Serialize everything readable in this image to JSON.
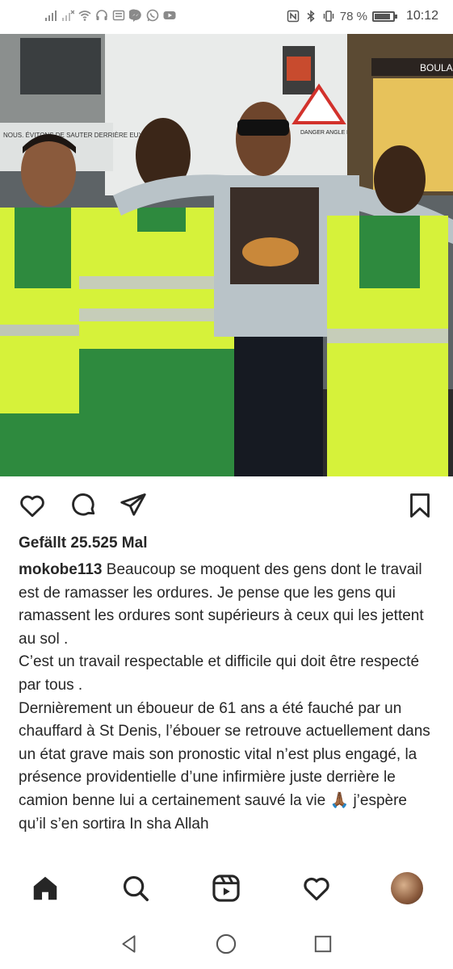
{
  "status_bar": {
    "battery_percent_text": "78 %",
    "battery_level": 0.78,
    "time": "10:12",
    "left_icons": [
      "signal-icon",
      "signal-no-sim-icon",
      "wifi-icon",
      "headphones-icon",
      "news-icon",
      "messenger-icon",
      "whatsapp-icon",
      "youtube-icon"
    ],
    "right_icons": [
      "nfc-icon",
      "bluetooth-icon",
      "vibrate-icon",
      "battery-icon"
    ]
  },
  "photo": {
    "sign_truck_text": "NOUS. ÉVITONS DE SAUTER DERRIÈRE EUX.",
    "sign_danger_text": "DANGER ANGLE MORT",
    "sign_shop_text": "BOULA"
  },
  "actions": {
    "icons": [
      "heart-icon",
      "comment-icon",
      "share-icon",
      "bookmark-icon"
    ]
  },
  "post": {
    "likes": "Gefällt 25.525 Mal",
    "username": "mokobe113",
    "caption_line1": " Beaucoup se moquent des gens dont le travail est de ramasser les ordures. Je pense que les gens qui ramassent les ordures sont supérieurs à ceux qui les jettent au sol .",
    "caption_line2": "C’est un travail respectable et difficile qui doit être respecté par tous .",
    "caption_line3": "Dernièrement un éboueur de 61 ans a été fauché par un chauffard à St Denis, l’ébouer se retrouve actuellement dans un état grave mais son pronostic vital n’est plus engagé, la présence providentielle d’une infirmière juste derrière le camion benne lui a certainement sauvé la vie 🙏🏾 j’espère qu’il s’en sortira In sha Allah"
  },
  "bottom_nav": {
    "items": [
      "home-icon",
      "search-icon",
      "reels-icon",
      "activity-heart-icon",
      "profile-avatar"
    ]
  },
  "system_nav": {
    "items": [
      "back-icon",
      "home-circle-icon",
      "recents-icon"
    ]
  },
  "colors": {
    "text": "#262626",
    "hi_vis_yellow": "#d6f23a",
    "work_green": "#2e8a3e"
  }
}
